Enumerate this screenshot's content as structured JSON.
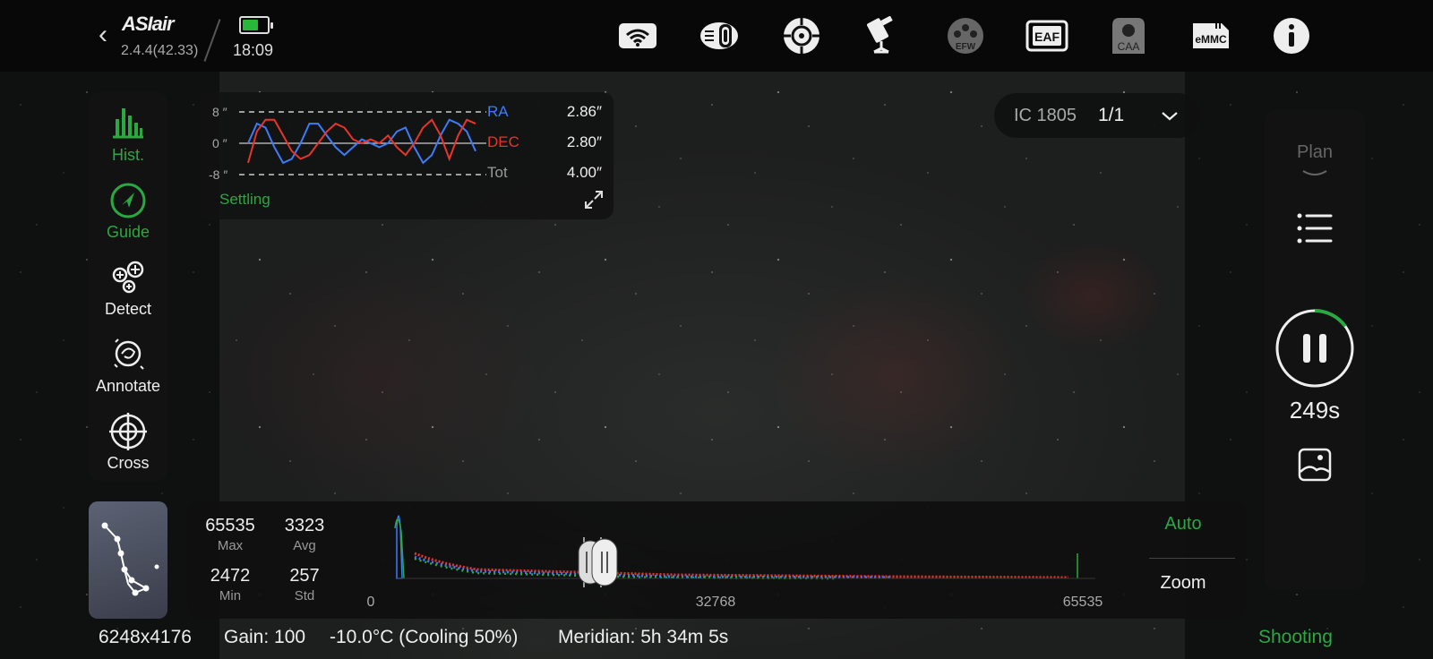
{
  "app": {
    "logo": "ASIair",
    "version": "2.4.4(42.33)",
    "time": "18:09",
    "battery_level": 0.65
  },
  "toolbar_icons": [
    "wifi-icon",
    "camera-lens-icon",
    "guide-scope-icon",
    "telescope-mount-icon",
    "filter-wheel-icon",
    "focuser-icon",
    "camera-angle-adjuster-icon",
    "emmc-storage-icon",
    "info-icon"
  ],
  "toolbar_labels": {
    "efw": "EFW",
    "eaf": "EAF",
    "caa": "CAA",
    "emmc": "eMMC"
  },
  "tools": [
    {
      "label": "Hist.",
      "icon": "histogram-icon",
      "active": true
    },
    {
      "label": "Guide",
      "icon": "guide-compass-icon",
      "active": true
    },
    {
      "label": "Detect",
      "icon": "detect-stars-icon",
      "active": false
    },
    {
      "label": "Annotate",
      "icon": "annotate-galaxy-icon",
      "active": false
    },
    {
      "label": "Cross",
      "icon": "crosshair-icon",
      "active": false
    }
  ],
  "guide": {
    "y_labels": [
      "8 ″",
      "0 ″",
      "-8 ″"
    ],
    "ra_label": "RA",
    "ra_value": "2.86″",
    "dec_label": "DEC",
    "dec_value": "2.80″",
    "tot_label": "Tot",
    "tot_value": "4.00″",
    "status": "Settling",
    "ra_color": "#3d7bf7",
    "dec_color": "#e8342c",
    "ra_points": [
      0,
      5,
      4,
      -1,
      -5,
      -4,
      0,
      5,
      5,
      2,
      -1,
      -3,
      -1,
      1,
      0,
      -1,
      0,
      3,
      4,
      -1,
      -5,
      -3,
      2,
      6,
      5,
      3,
      -2
    ],
    "dec_points": [
      -5,
      3,
      6,
      6,
      2,
      -2,
      -4,
      -3,
      0,
      3,
      5,
      4,
      1,
      0,
      1,
      0,
      2,
      -1,
      -3,
      0,
      4,
      6,
      2,
      -4,
      2,
      6,
      5
    ]
  },
  "target": {
    "name": "IC 1805",
    "count": "1/1"
  },
  "plan": {
    "label": "Plan",
    "timer": "249s",
    "progress": 0.15
  },
  "histogram": {
    "max_value": "65535",
    "max_label": "Max",
    "avg_value": "3323",
    "avg_label": "Avg",
    "min_value": "2472",
    "min_label": "Min",
    "std_value": "257",
    "std_label": "Std",
    "axis_min": "0",
    "axis_mid": "32768",
    "axis_max": "65535",
    "auto_label": "Auto",
    "zoom_label": "Zoom"
  },
  "status": {
    "resolution": "6248x4176",
    "gain": "Gain: 100",
    "temperature": "-10.0°C (Cooling 50%)",
    "meridian": "Meridian: 5h 34m 5s",
    "state": "Shooting"
  },
  "colors": {
    "accent": "#2aa842",
    "ra": "#3d7bf7",
    "dec": "#e8342c"
  }
}
